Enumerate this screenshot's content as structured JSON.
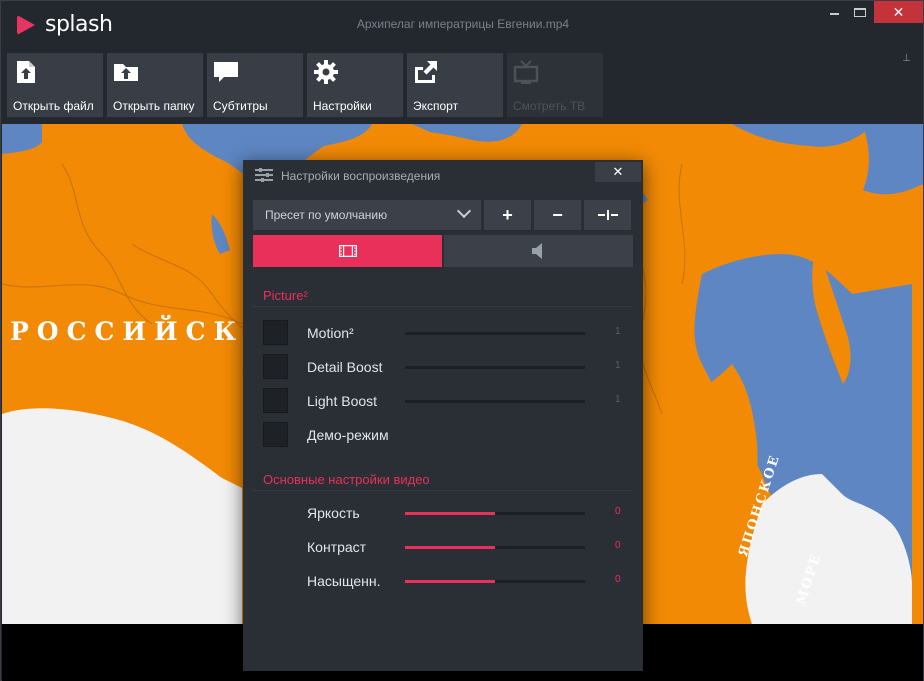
{
  "app": {
    "brand": "splash",
    "window_title": "Архипелаг императрицы Евгении.mp4"
  },
  "toolbar": {
    "items": [
      {
        "label": "Открыть файл",
        "icon": "open-file-icon",
        "enabled": true
      },
      {
        "label": "Открыть папку",
        "icon": "open-folder-icon",
        "enabled": true
      },
      {
        "label": "Субтитры",
        "icon": "subtitles-icon",
        "enabled": true
      },
      {
        "label": "Настройки",
        "icon": "gear-icon",
        "enabled": true
      },
      {
        "label": "Экспорт",
        "icon": "export-icon",
        "enabled": true
      },
      {
        "label": "Смотреть ТВ",
        "icon": "tv-icon",
        "enabled": false
      }
    ]
  },
  "video": {
    "map_label_country": "РОССИЙСКА",
    "map_label_sea_1": "ЯПОНСКОЕ",
    "map_label_sea_2": "МОРЕ"
  },
  "panel": {
    "title": "Настройки воспроизведения",
    "preset_value": "Пресет по умолчанию",
    "buttons": {
      "add": "+",
      "remove": "−",
      "reset": "-I-"
    },
    "tabs": [
      {
        "icon": "film-icon",
        "active": true
      },
      {
        "icon": "speaker-icon",
        "active": false
      }
    ],
    "picture_section": {
      "title": "Picture²",
      "rows": [
        {
          "label": "Motion²",
          "value": "1",
          "checked": false
        },
        {
          "label": "Detail Boost",
          "value": "1",
          "checked": false
        },
        {
          "label": "Light Boost",
          "value": "1",
          "checked": false
        },
        {
          "label": "Демо-режим",
          "checked": false
        }
      ]
    },
    "video_section": {
      "title": "Основные настройки видео",
      "rows": [
        {
          "label": "Яркость",
          "value": "0",
          "level": 0.5
        },
        {
          "label": "Контраст",
          "value": "0",
          "level": 0.5
        },
        {
          "label": "Насыщенн.",
          "value": "0",
          "level": 0.5
        }
      ]
    }
  },
  "colors": {
    "accent": "#e8305a",
    "map_land": "#f28a06",
    "map_water": "#5e86c2"
  }
}
